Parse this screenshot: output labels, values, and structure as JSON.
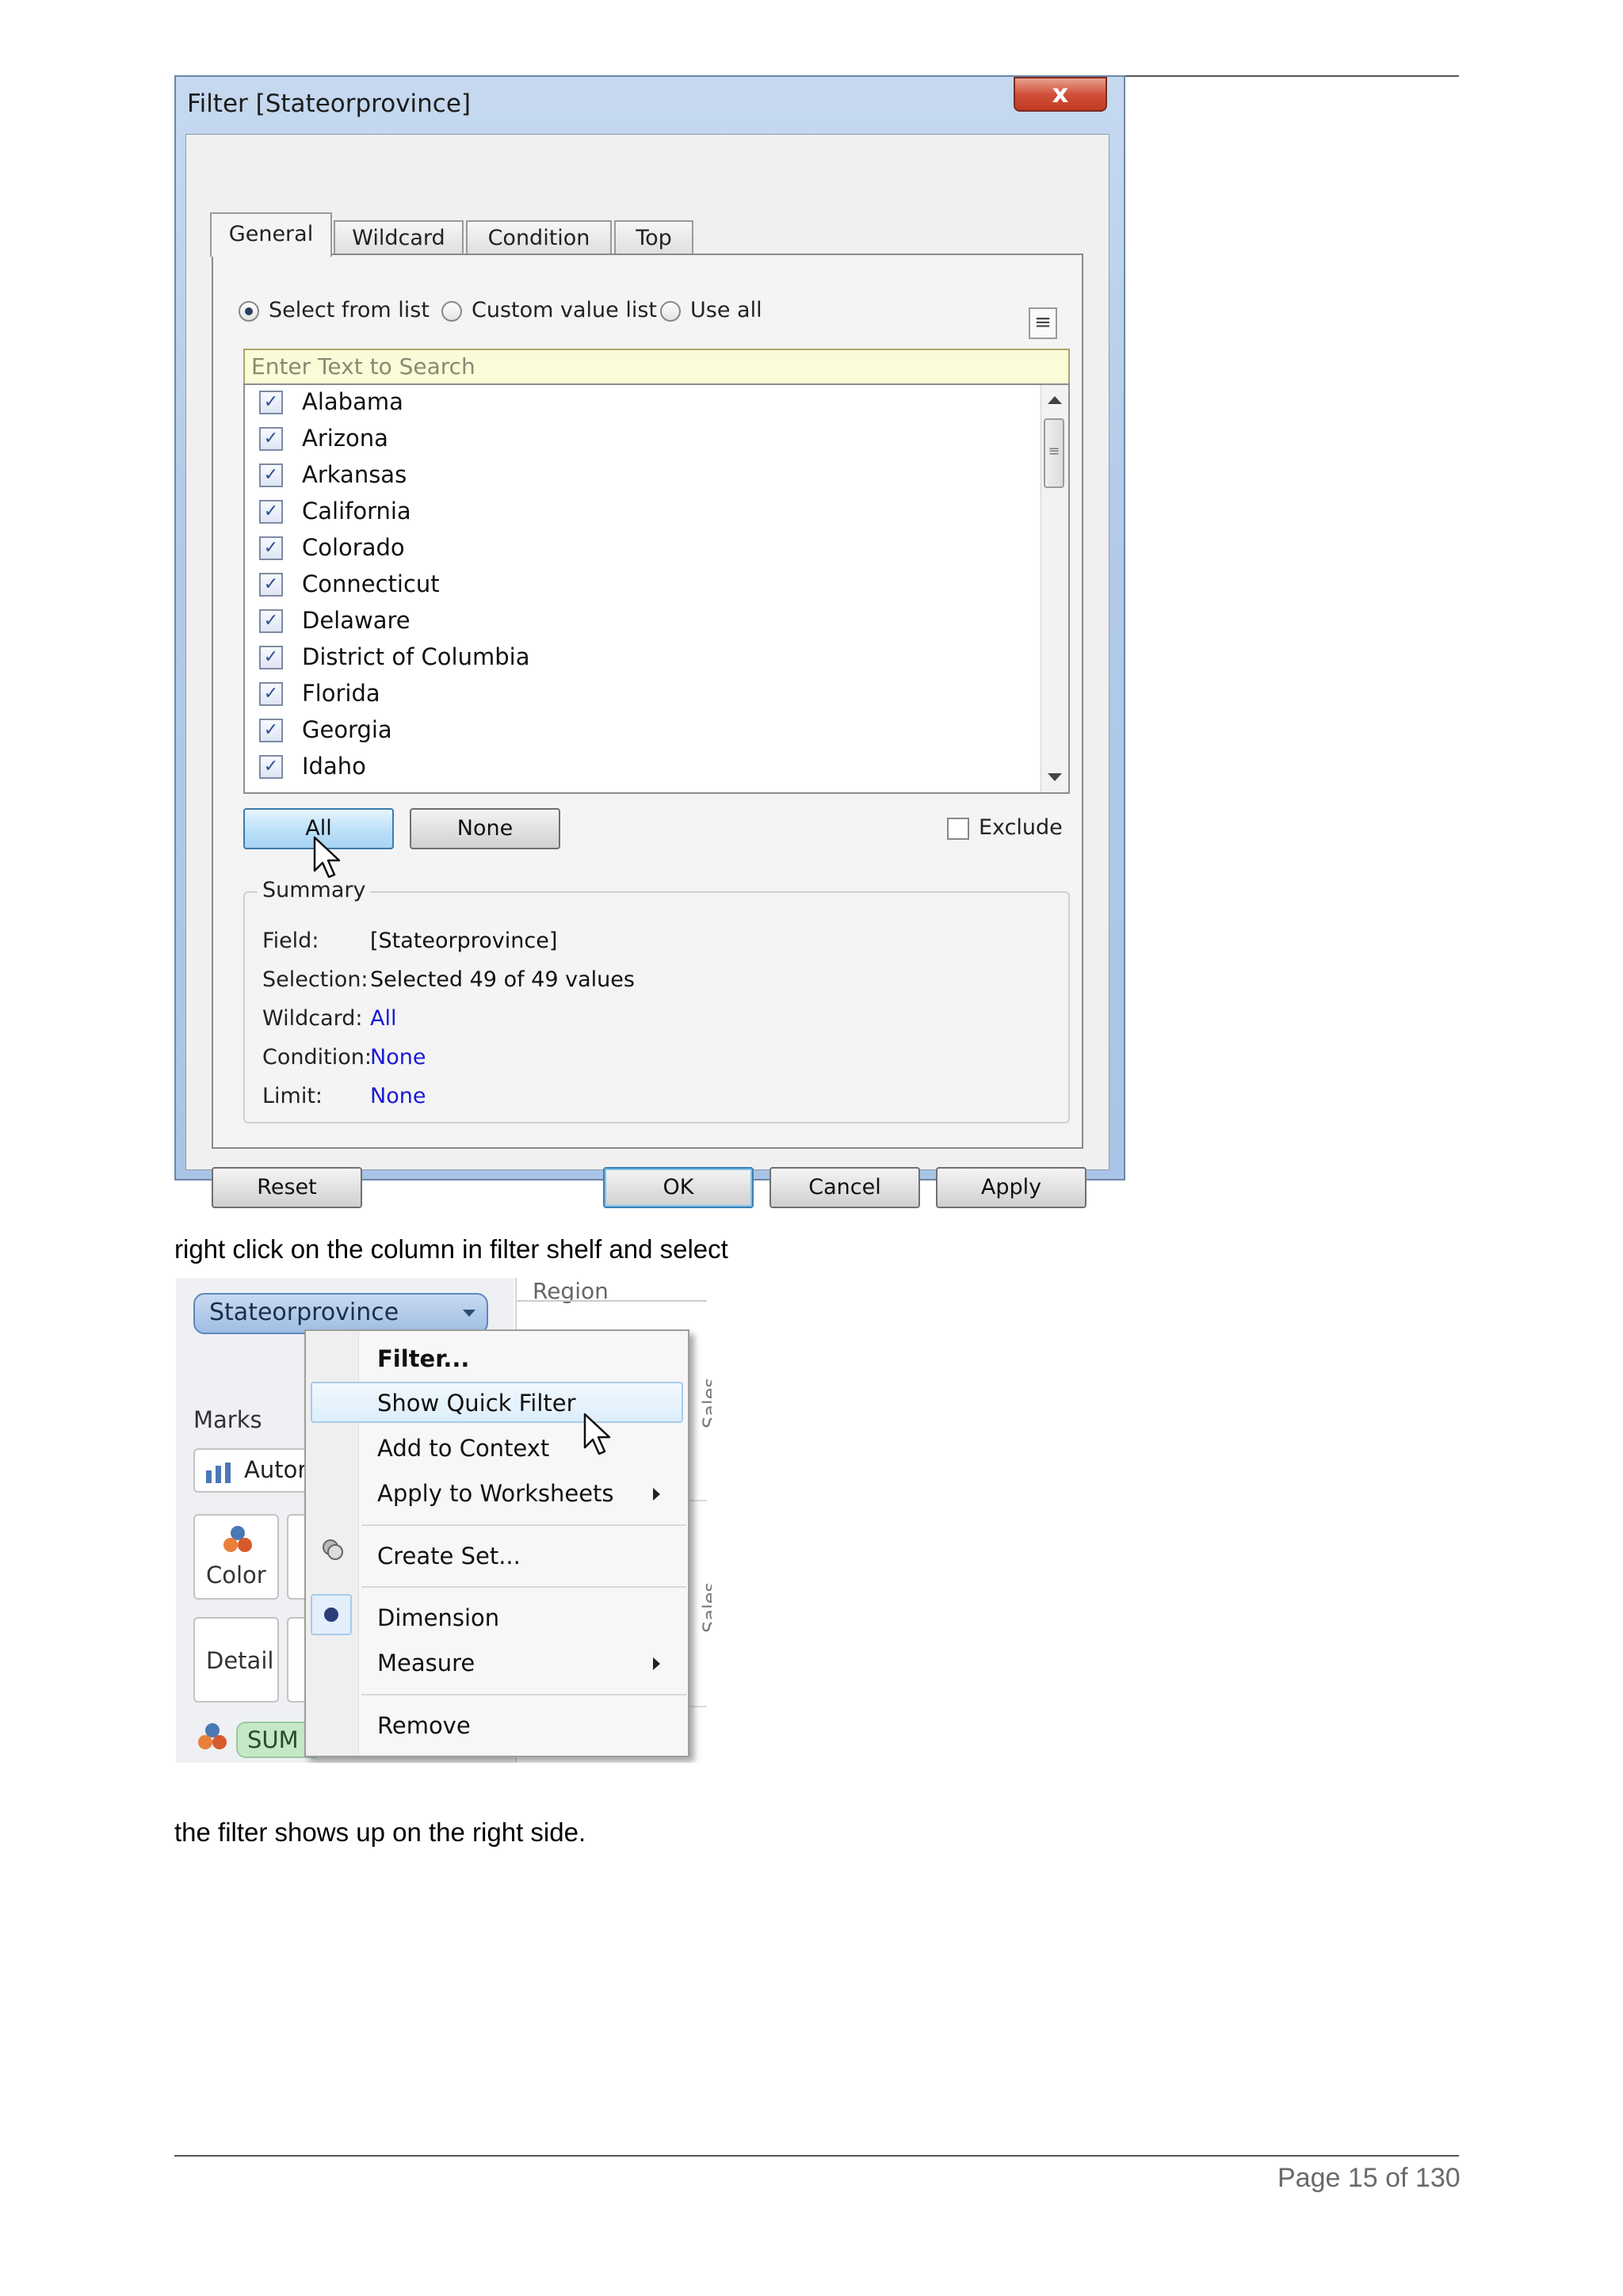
{
  "dialog": {
    "title": "Filter [Stateorprovince]",
    "close_glyph": "x",
    "tabs": [
      "General",
      "Wildcard",
      "Condition",
      "Top"
    ],
    "radios": [
      {
        "label": "Select from list",
        "selected": true
      },
      {
        "label": "Custom value list",
        "selected": false
      },
      {
        "label": "Use all",
        "selected": false
      }
    ],
    "menu_glyph": "≡",
    "search_placeholder": "Enter Text to Search",
    "items": [
      {
        "label": "Alabama",
        "checked": true
      },
      {
        "label": "Arizona",
        "checked": true
      },
      {
        "label": "Arkansas",
        "checked": true
      },
      {
        "label": "California",
        "checked": true
      },
      {
        "label": "Colorado",
        "checked": true
      },
      {
        "label": "Connecticut",
        "checked": true
      },
      {
        "label": "Delaware",
        "checked": true
      },
      {
        "label": "District of Columbia",
        "checked": true
      },
      {
        "label": "Florida",
        "checked": true
      },
      {
        "label": "Georgia",
        "checked": true
      },
      {
        "label": "Idaho",
        "checked": true
      }
    ],
    "check_glyph": "✓",
    "all_button": "All",
    "none_button": "None",
    "exclude_label": "Exclude",
    "summary": {
      "title": "Summary",
      "field_key": "Field:",
      "field_val": "[Stateorprovince]",
      "selection_key": "Selection:",
      "selection_val": "Selected 49 of 49 values",
      "wildcard_key": "Wildcard:",
      "wildcard_val": "All",
      "condition_key": "Condition:",
      "condition_val": "None",
      "limit_key": "Limit:",
      "limit_val": "None"
    },
    "reset_button": "Reset",
    "ok_button": "OK",
    "cancel_button": "Cancel",
    "apply_button": "Apply"
  },
  "text": {
    "instruction": "right click on the column in filter shelf and select",
    "result": "the filter shows up on the right side."
  },
  "shelf": {
    "pill_label": "Stateorprovince",
    "region_label": "Region",
    "sales_label": "Sales",
    "marks_label": "Marks",
    "automatic_label": "Autor",
    "color_label": "Color",
    "detail_label": "Detail",
    "sum_label": "SUM"
  },
  "context_menu": {
    "filter": "Filter...",
    "show_quick_filter": "Show Quick Filter",
    "add_to_context": "Add to Context",
    "apply_to_worksheets": "Apply to Worksheets",
    "create_set": "Create Set...",
    "dimension": "Dimension",
    "measure": "Measure",
    "remove": "Remove"
  },
  "footer": {
    "page_label": "Page 15 of 130"
  },
  "colors": {
    "link": "#1a1ad6",
    "titlebar": "#b3cbe8",
    "search_bg": "#fbfbd8",
    "pill": "#9fbde3"
  }
}
